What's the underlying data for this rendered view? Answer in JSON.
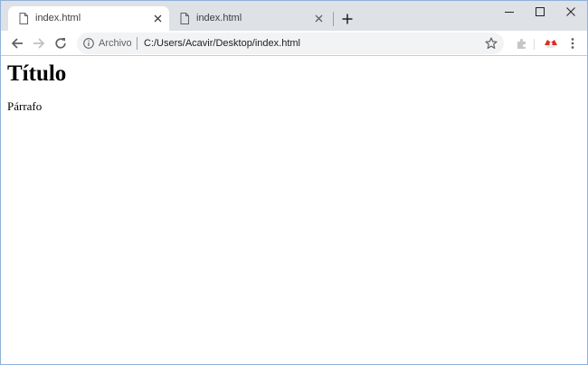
{
  "tabs": [
    {
      "title": "index.html",
      "active": true
    },
    {
      "title": "index.html",
      "active": false
    }
  ],
  "toolbar": {
    "omnibox": {
      "scheme_label": "Archivo",
      "url": "C:/Users/Acavir/Desktop/index.html"
    }
  },
  "page": {
    "heading": "Título",
    "paragraph": "Párrafo"
  },
  "icons": {
    "tab_favicon": "file-icon",
    "tab_close": "close-icon",
    "new_tab": "plus-icon",
    "back": "arrow-left-icon",
    "forward": "arrow-right-icon",
    "reload": "reload-icon",
    "site_info": "info-icon",
    "bookmark": "star-icon",
    "extension": "puzzle-icon",
    "profile_extension": "extension-badge-icon",
    "menu": "kebab-menu-icon",
    "window_minimize": "minimize-icon",
    "window_maximize": "maximize-icon",
    "window_close": "window-close-icon"
  },
  "colors": {
    "tabstrip_bg": "#dee1e6",
    "omnibox_bg": "#f1f3f4",
    "window_border": "#8fb2d9",
    "icon_gray": "#5f6368",
    "extension_red": "#d93025"
  }
}
